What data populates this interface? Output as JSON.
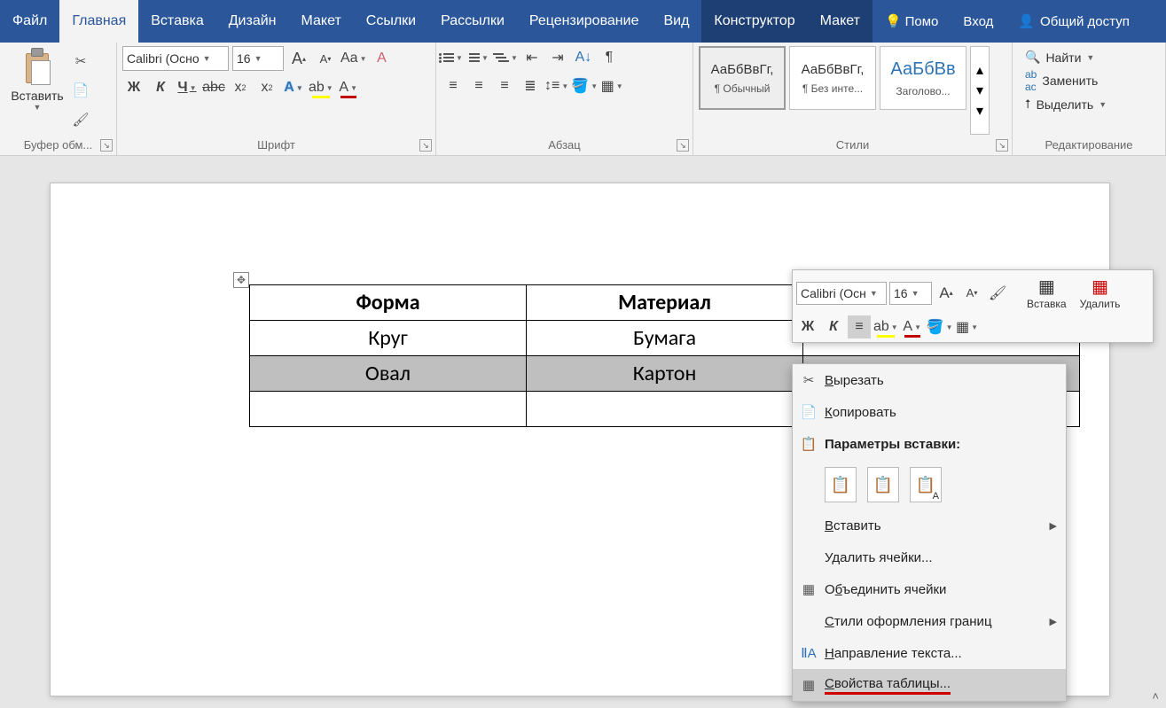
{
  "tabs": {
    "file": "Файл",
    "home": "Главная",
    "insert": "Вставка",
    "design": "Дизайн",
    "layout": "Макет",
    "references": "Ссылки",
    "mailings": "Рассылки",
    "review": "Рецензирование",
    "view": "Вид",
    "ctx_design": "Конструктор",
    "ctx_layout": "Макет",
    "tell_me": "Помо",
    "sign_in": "Вход",
    "share": "Общий доступ"
  },
  "ribbon": {
    "clipboard": {
      "paste": "Вставить",
      "label": "Буфер обм..."
    },
    "font": {
      "name": "Calibri (Осно",
      "size": "16",
      "grow": "A",
      "shrink": "A",
      "case": "Aa",
      "clear": "A",
      "bold": "Ж",
      "italic": "К",
      "underline": "Ч",
      "strike": "abc",
      "sub": "x",
      "sup": "x",
      "effects": "A",
      "highlight": "ab",
      "color": "A",
      "label": "Шрифт"
    },
    "paragraph": {
      "label": "Абзац"
    },
    "styles": {
      "sample": "АаБбВвГг,",
      "normal": "¶ Обычный",
      "nospacing": "¶ Без инте...",
      "heading_sample": "АаБбВв",
      "heading1": "Заголово...",
      "label": "Стили"
    },
    "editing": {
      "find": "Найти",
      "replace": "Заменить",
      "select": "Выделить",
      "label": "Редактирование"
    }
  },
  "table": {
    "headers": [
      "Форма",
      "Материал",
      ""
    ],
    "rows": [
      [
        "Круг",
        "Бумага",
        ""
      ],
      [
        "Овал",
        "Картон",
        ""
      ],
      [
        "",
        "",
        ""
      ]
    ],
    "selected_row_index": 1
  },
  "mini_toolbar": {
    "font": "Calibri (Осн",
    "size": "16",
    "bold": "Ж",
    "italic": "К",
    "insert": "Вставка",
    "delete": "Удалить"
  },
  "context_menu": {
    "cut": "Вырезать",
    "copy": "Копировать",
    "paste_options": "Параметры вставки:",
    "insert": "Вставить",
    "delete_cells": "Удалить ячейки...",
    "merge_cells": "Объединить ячейки",
    "border_styles": "Стили оформления границ",
    "text_direction": "Направление текста...",
    "table_properties": "Свойства таблицы..."
  }
}
